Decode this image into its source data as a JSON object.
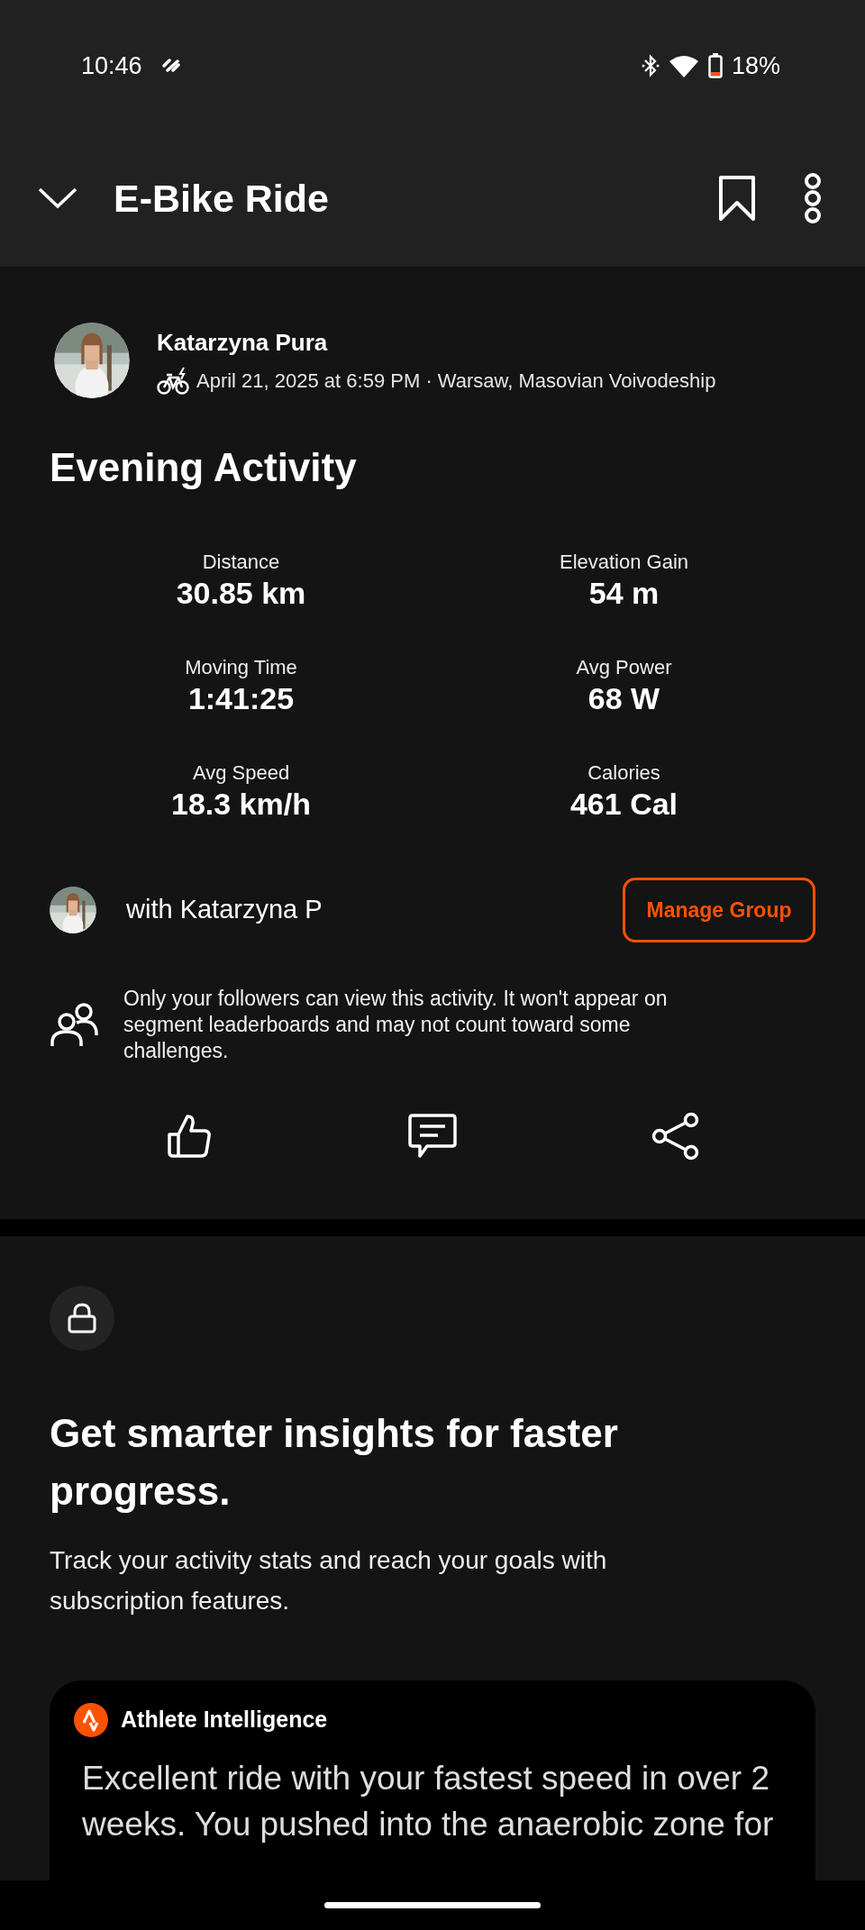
{
  "status_bar": {
    "time": "10:46",
    "battery": "18%"
  },
  "header": {
    "title": "E-Bike Ride"
  },
  "athlete": {
    "name": "Katarzyna Pura",
    "meta": "April 21, 2025 at 6:59 PM · Warsaw, Masovian Voivodeship"
  },
  "activity": {
    "title": "Evening Activity",
    "stats": [
      {
        "label": "Distance",
        "value": "30.85 km"
      },
      {
        "label": "Elevation Gain",
        "value": "54 m"
      },
      {
        "label": "Moving Time",
        "value": "1:41:25"
      },
      {
        "label": "Avg Power",
        "value": "68 W"
      },
      {
        "label": "Avg Speed",
        "value": "18.3 km/h"
      },
      {
        "label": "Calories",
        "value": "461 Cal"
      }
    ]
  },
  "group": {
    "text": "with Katarzyna P",
    "button": "Manage Group"
  },
  "privacy_notice": "Only your followers can view this activity. It won't appear on segment leaderboards and may not count toward some challenges.",
  "upsell": {
    "title": "Get smarter insights for faster progress.",
    "subtitle": "Track your activity stats and reach your goals with subscription features.",
    "card": {
      "title": "Athlete Intelligence",
      "body": "Excellent ride with your fastest speed in over 2 weeks. You pushed into the anaerobic zone for"
    }
  }
}
